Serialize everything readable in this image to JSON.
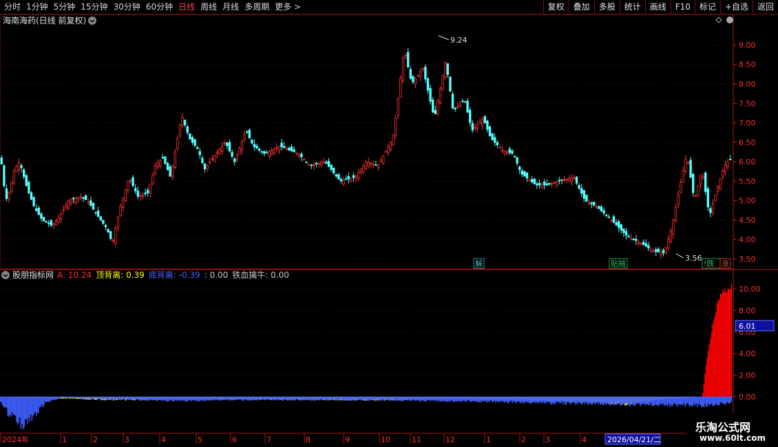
{
  "periods": [
    {
      "label": "分时",
      "active": false
    },
    {
      "label": "1分钟",
      "active": false
    },
    {
      "label": "5分钟",
      "active": false
    },
    {
      "label": "15分钟",
      "active": false
    },
    {
      "label": "30分钟",
      "active": false
    },
    {
      "label": "60分钟",
      "active": false
    },
    {
      "label": "日线",
      "active": true
    },
    {
      "label": "周线",
      "active": false
    },
    {
      "label": "月线",
      "active": false
    },
    {
      "label": "多周期",
      "active": false
    },
    {
      "label": "更多 >",
      "active": false
    }
  ],
  "tools": [
    "复权",
    "叠加",
    "多股",
    "统计",
    "画线",
    "F10",
    "标记",
    "+自选",
    "返回"
  ],
  "main_title": "海南海药(日线 前复权)",
  "price_axis": [
    "9.00",
    "8.50",
    "8.00",
    "7.50",
    "7.00",
    "6.50",
    "6.00",
    "5.50",
    "5.00",
    "4.50",
    "4.00",
    "3.50"
  ],
  "high_label": "9.24",
  "low_label": "3.56",
  "markers": [
    {
      "text": "解",
      "color": "#40c0c0"
    },
    {
      "text": "贴贼",
      "color": "#30c060"
    },
    {
      "text": "!跌",
      "color": "#30c060"
    },
    {
      "text": "涨",
      "color": "#d05030"
    }
  ],
  "indicator": {
    "name": "股朋指标网",
    "items": [
      {
        "label": "A: 10.24",
        "color": "#ff3030"
      },
      {
        "label": "顶背离: 0.39",
        "color": "#ffff00"
      },
      {
        "label": "底背离: -0.39",
        "color": "#4060ff"
      },
      {
        "label": ": 0.00",
        "color": "#c8c8c8"
      },
      {
        "label": "铁血擒牛: 0.00",
        "color": "#c8c8c8"
      }
    ]
  },
  "ind_axis": [
    "10.00",
    "8.00",
    "6.00",
    "4.00",
    "2.00",
    "0.00"
  ],
  "cursor_value": "6.01",
  "date_axis": [
    "2024年",
    "1",
    "2",
    "3",
    "4",
    "5",
    "6",
    "7",
    "8",
    "9",
    "10",
    "11",
    "12",
    "1",
    "2",
    "3",
    "4"
  ],
  "current_date": "2026/04/21/二",
  "watermark": {
    "line1": "乐淘公式网",
    "line2": "www.60lt.com"
  },
  "chart_data": [
    {
      "type": "candlestick",
      "title": "海南海药(日线 前复权)",
      "ylim": [
        3.35,
        9.45
      ],
      "high": 9.24,
      "low": 3.56,
      "close_anchors": [
        [
          0,
          6.1
        ],
        [
          4,
          5.4
        ],
        [
          8,
          5.0
        ],
        [
          12,
          5.3
        ],
        [
          18,
          5.8
        ],
        [
          25,
          6.0
        ],
        [
          35,
          5.3
        ],
        [
          45,
          4.8
        ],
        [
          55,
          4.5
        ],
        [
          68,
          4.35
        ],
        [
          78,
          4.6
        ],
        [
          90,
          5.0
        ],
        [
          105,
          5.1
        ],
        [
          115,
          5.0
        ],
        [
          125,
          4.7
        ],
        [
          140,
          4.3
        ],
        [
          148,
          3.9
        ],
        [
          158,
          4.8
        ],
        [
          170,
          5.6
        ],
        [
          182,
          5.1
        ],
        [
          195,
          5.2
        ],
        [
          205,
          5.9
        ],
        [
          215,
          6.1
        ],
        [
          225,
          5.6
        ],
        [
          240,
          7.2
        ],
        [
          250,
          6.6
        ],
        [
          262,
          6.3
        ],
        [
          270,
          5.8
        ],
        [
          285,
          6.2
        ],
        [
          298,
          6.5
        ],
        [
          310,
          6.0
        ],
        [
          325,
          6.8
        ],
        [
          335,
          6.4
        ],
        [
          350,
          6.2
        ],
        [
          370,
          6.4
        ],
        [
          395,
          6.2
        ],
        [
          410,
          5.9
        ],
        [
          430,
          6.0
        ],
        [
          450,
          5.5
        ],
        [
          470,
          5.6
        ],
        [
          485,
          6.0
        ],
        [
          500,
          5.9
        ],
        [
          520,
          6.6
        ],
        [
          525,
          7.3
        ],
        [
          535,
          8.9
        ],
        [
          545,
          8.0
        ],
        [
          560,
          8.4
        ],
        [
          575,
          7.1
        ],
        [
          590,
          8.6
        ],
        [
          600,
          7.3
        ],
        [
          615,
          7.6
        ],
        [
          625,
          6.8
        ],
        [
          640,
          7.1
        ],
        [
          650,
          6.6
        ],
        [
          665,
          6.3
        ],
        [
          680,
          6.2
        ],
        [
          690,
          5.7
        ],
        [
          710,
          5.4
        ],
        [
          725,
          5.4
        ],
        [
          740,
          5.5
        ],
        [
          760,
          5.6
        ],
        [
          775,
          5.0
        ],
        [
          790,
          4.85
        ],
        [
          810,
          4.5
        ],
        [
          830,
          4.1
        ],
        [
          850,
          3.9
        ],
        [
          865,
          3.7
        ],
        [
          880,
          3.65
        ],
        [
          890,
          4.3
        ],
        [
          900,
          5.3
        ],
        [
          910,
          6.2
        ],
        [
          920,
          5.0
        ],
        [
          930,
          5.8
        ],
        [
          940,
          4.6
        ],
        [
          950,
          5.3
        ],
        [
          960,
          5.9
        ],
        [
          970,
          6.1
        ]
      ],
      "markers": [
        "解",
        "贴贼",
        "!跌",
        "涨"
      ]
    },
    {
      "type": "bar",
      "title": "股朋指标网",
      "ylim": [
        -2.8,
        10.5
      ],
      "series": [
        {
          "name": "A",
          "color": "#ff0000",
          "values_note": "0 before 2026/04 breakout; rises to about 8.6 then stays near 9.6–10.3",
          "anchors": [
            [
              0,
              0
            ],
            [
              930,
              0
            ],
            [
              935,
              3.0
            ],
            [
              940,
              5.2
            ],
            [
              945,
              7.0
            ],
            [
              950,
              8.6
            ],
            [
              955,
              9.6
            ],
            [
              960,
              9.8
            ],
            [
              970,
              10.2
            ]
          ]
        },
        {
          "name": "顶背离",
          "color": "#ffff00",
          "anchors": [
            [
              0,
              0
            ],
            [
              90,
              -0.15
            ],
            [
              150,
              -0.3
            ],
            [
              250,
              -0.2
            ],
            [
              400,
              -0.25
            ],
            [
              500,
              -0.3
            ],
            [
              600,
              -0.2
            ],
            [
              700,
              -0.3
            ],
            [
              780,
              -0.45
            ],
            [
              830,
              -0.65
            ],
            [
              870,
              -0.3
            ],
            [
              930,
              0
            ]
          ]
        },
        {
          "name": "底背离",
          "color": "#4060ff",
          "anchors": [
            [
              0,
              -0.4
            ],
            [
              10,
              -1.5
            ],
            [
              30,
              -2.6
            ],
            [
              45,
              -1.8
            ],
            [
              60,
              -0.6
            ],
            [
              80,
              -0.1
            ],
            [
              240,
              -0.4
            ],
            [
              300,
              -0.3
            ],
            [
              500,
              -0.3
            ],
            [
              940,
              -0.8
            ],
            [
              970,
              -0.5
            ]
          ]
        }
      ]
    }
  ]
}
